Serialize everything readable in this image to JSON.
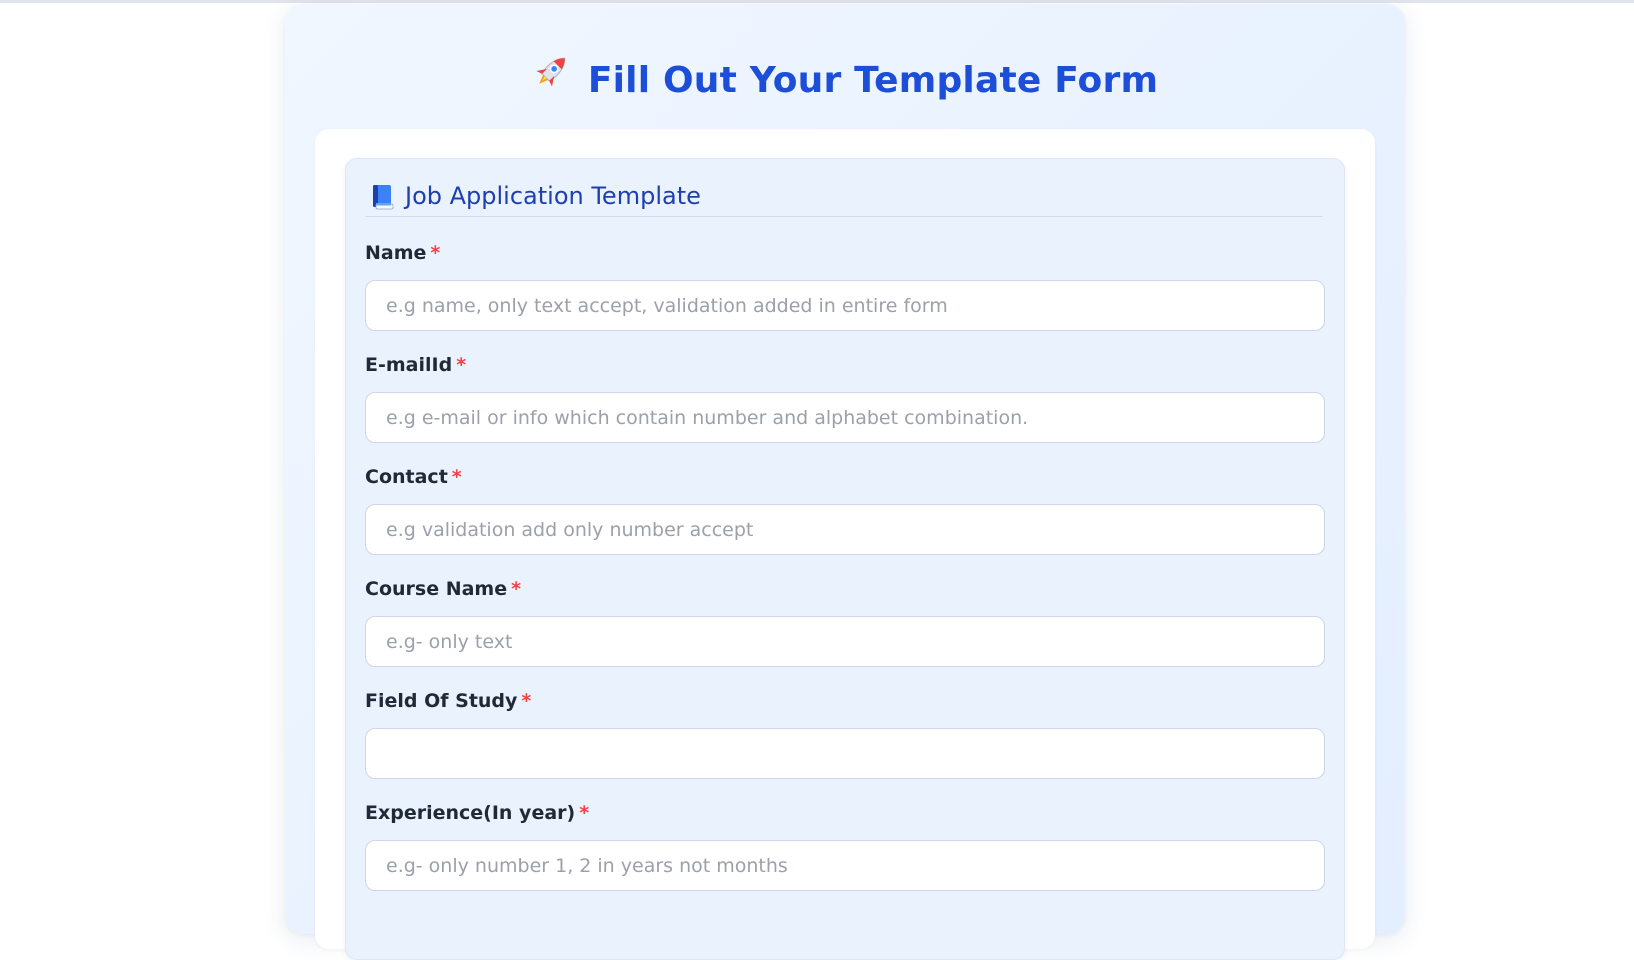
{
  "page": {
    "title": "Fill Out Your Template Form",
    "title_icon": "rocket-icon"
  },
  "section": {
    "title": "Job Application Template",
    "icon": "blue-book-icon"
  },
  "required_marker": "*",
  "fields": [
    {
      "label": "Name",
      "placeholder": "e.g name, only text accept, validation added in entire form",
      "value": ""
    },
    {
      "label": "E-mailId",
      "placeholder": "e.g e-mail or info which contain number and alphabet combination.",
      "value": ""
    },
    {
      "label": "Contact",
      "placeholder": "e.g validation add only number accept",
      "value": ""
    },
    {
      "label": "Course Name",
      "placeholder": "e.g- only text",
      "value": ""
    },
    {
      "label": "Field Of Study",
      "placeholder": "",
      "value": ""
    },
    {
      "label": "Experience(In year)",
      "placeholder": "e.g- only number 1, 2 in years not months",
      "value": ""
    }
  ],
  "colors": {
    "title": "#1d4ed8",
    "section_title": "#1e40af",
    "required": "#ef4444",
    "section_background": "#eaf2fe"
  }
}
